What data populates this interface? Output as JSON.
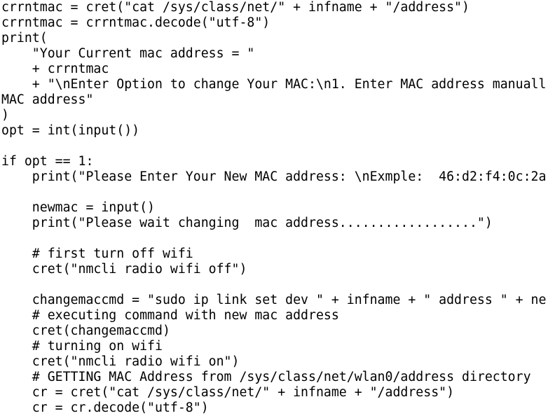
{
  "editor": {
    "lines": [
      "crrntmac = cret(\"cat /sys/class/net/\" + infname + \"/address\")",
      "crrntmac = crrntmac.decode(\"utf-8\")",
      "print(",
      "    \"Your Current mac address = \"",
      "    + crrntmac",
      "    + \"\\nEnter Option to change Your MAC:\\n1. Enter MAC address manuall",
      "MAC address\"",
      ")",
      "opt = int(input())",
      "",
      "if opt == 1:",
      "    print(\"Please Enter Your New MAC address: \\nExmple:  46:d2:f4:0c:2a",
      "",
      "    newmac = input()",
      "    print(\"Please wait changing  mac address..................\")",
      "",
      "    # first turn off wifi",
      "    cret(\"nmcli radio wifi off\")",
      "",
      "    changemaccmd = \"sudo ip link set dev \" + infname + \" address \" + ne",
      "    # executing command with new mac address",
      "    cret(changemaccmd)",
      "    # turning on wifi",
      "    cret(\"nmcli radio wifi on\")",
      "    # GETTING MAC Address from /sys/class/net/wlan0/address directory",
      "    cr = cret(\"cat /sys/class/net/\" + infname + \"/address\")",
      "    cr = cr.decode(\"utf-8\")"
    ]
  }
}
